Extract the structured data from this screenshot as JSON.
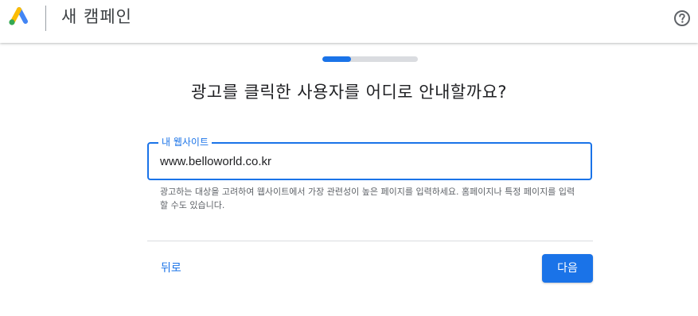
{
  "header": {
    "title": "새 캠페인",
    "logo_icon": "google-ads-logo",
    "help_icon": "help-circle-icon"
  },
  "progress": {
    "value": 0.3,
    "track_color": "#dadce0",
    "fill_color": "#1a73e8"
  },
  "main": {
    "question": "광고를 클릭한 사용자를 어디로 안내할까요?",
    "website_field": {
      "label": "내 웹사이트",
      "value": "www.belloworld.co.kr"
    },
    "helper_text": "광고하는 대상을 고려하여 웹사이트에서 가장 관련성이 높은 페이지를 입력하세요. 홈페이지나 특정 페이지를 입력할 수도 있습니다."
  },
  "footer": {
    "back_label": "뒤로",
    "next_label": "다음"
  },
  "colors": {
    "accent": "#1a73e8",
    "logo_blue": "#4285f4",
    "logo_yellow": "#fbbc04",
    "logo_green": "#34a853"
  }
}
